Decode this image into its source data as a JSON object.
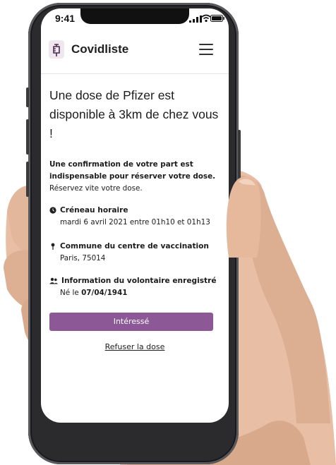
{
  "status": {
    "time": "9:41"
  },
  "header": {
    "brand": "Covidliste"
  },
  "main": {
    "title": "Une dose de Pfizer est disponible à 3km de chez vous !",
    "confirm_bold": "Une confirmation de votre part est indispensable pour réserver votre dose.",
    "confirm_text": "Réservez vite votre dose.",
    "slot_label": "Créneau horaire",
    "slot_value": "mardi 6 avril 2021 entre 01h10 et 01h13",
    "place_label": "Commune du centre de vaccination",
    "place_value": "Paris, 75014",
    "volunteer_label": "Information du volontaire enregistré",
    "volunteer_prefix": "Né le",
    "volunteer_date": "07/04/1941",
    "cta_label": "Intéressé",
    "refuse_label": "Refuser la dose"
  },
  "colors": {
    "accent": "#8c5896"
  }
}
